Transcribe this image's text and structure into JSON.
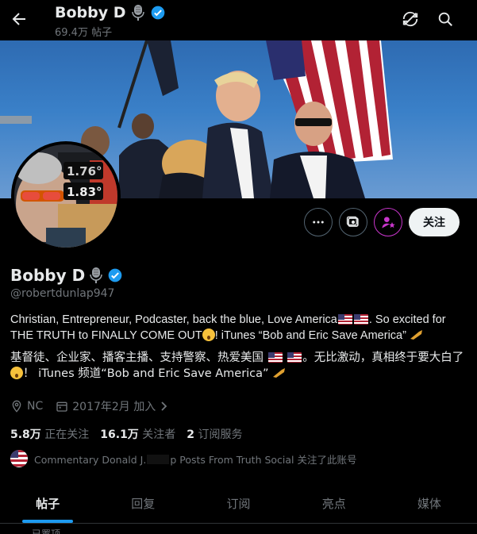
{
  "header": {
    "name": "Bobby D",
    "post_count": "69.4万 帖子",
    "icons": [
      "back-arrow-icon",
      "microphone-emoji-icon",
      "verified-badge-icon",
      "refresh-icon",
      "search-icon"
    ]
  },
  "profile": {
    "name": "Bobby D",
    "handle": "@robertdunlap947",
    "follow_label": "关注",
    "avatar_texts": {
      "line1": "1.76°",
      "line2": "1.83°"
    },
    "bio_en_1": "Christian, Entrepreneur, Podcaster, back the blue, Love America",
    "bio_en_2": ". So excited for THE TRUTH to FINALLY COME OUT",
    "bio_en_3": "! iTunes “Bob and Eric Save America”",
    "bio_zh_1": "基督徒、企业家、播客主播、支持警察、热爱美国 ",
    "bio_zh_2": "。无比激动，真相终于要大白了 ",
    "bio_zh_3": "！ iTunes 频道“Bob and Eric Save America”",
    "location": "NC",
    "joined": "2017年2月 加入",
    "stats": {
      "following_count": "5.8万",
      "following_label": "正在关注",
      "followers_count": "16.1万",
      "followers_label": "关注者",
      "subs_count": "2",
      "subs_label": "订阅服务"
    },
    "followed_by": "Commentary Donald J.",
    "followed_by_2": "p Posts From Truth Social 关注了此账号"
  },
  "tabs": [
    "帖子",
    "回复",
    "订阅",
    "亮点",
    "媒体"
  ],
  "footer_peek": "已置顶",
  "colors": {
    "accent": "#1d9bf0",
    "background": "#000000",
    "secondary_text": "#71767b",
    "subscribe_purple": "#c936cc"
  }
}
